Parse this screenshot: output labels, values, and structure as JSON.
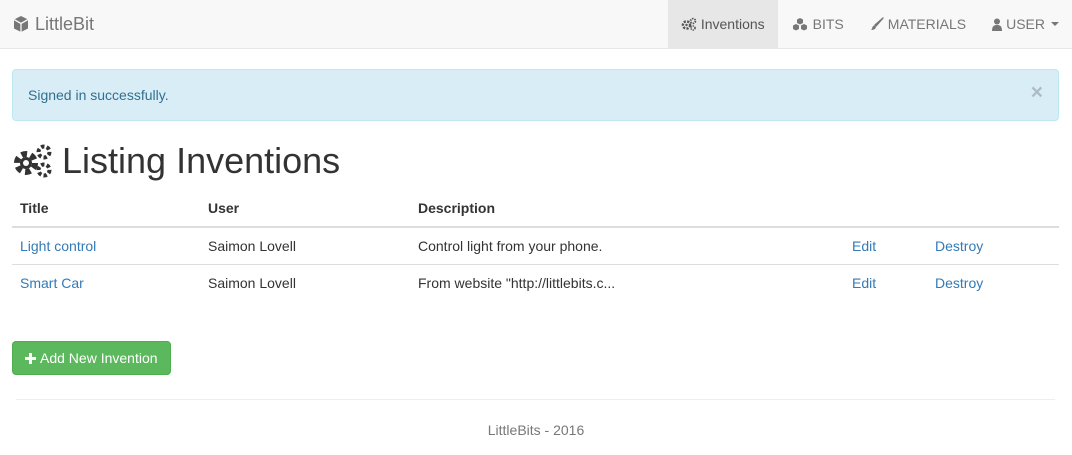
{
  "navbar": {
    "brand": "LittleBit",
    "brand_icon": "cube-icon",
    "items": [
      {
        "label": "Inventions",
        "icon": "cogs-icon",
        "active": true
      },
      {
        "label": "BITS",
        "icon": "cubes-icon",
        "active": false
      },
      {
        "label": "MATERIALS",
        "icon": "paintbrush-icon",
        "active": false
      },
      {
        "label": "USER",
        "icon": "user-icon",
        "active": false
      }
    ]
  },
  "alert": {
    "message": "Signed in successfully.",
    "close": "×"
  },
  "page": {
    "title": "Listing Inventions",
    "title_icon": "cogs-icon"
  },
  "table": {
    "headers": [
      "Title",
      "User",
      "Description",
      "",
      ""
    ],
    "rows": [
      {
        "title": "Light control",
        "user": "Saimon Lovell",
        "description": "Control light from your phone.",
        "edit": "Edit",
        "destroy": "Destroy"
      },
      {
        "title": "Smart Car",
        "user": "Saimon Lovell",
        "description": "From website \"http://littlebits.c...",
        "edit": "Edit",
        "destroy": "Destroy"
      }
    ]
  },
  "add_button": {
    "label": "Add New Invention",
    "icon": "plus-icon"
  },
  "footer": {
    "text": "LittleBits - 2016"
  },
  "colors": {
    "link": "#337ab7",
    "success": "#5cb85c",
    "alert_bg": "#d9edf7",
    "alert_text": "#31708f",
    "navbar_bg": "#f8f8f8"
  }
}
